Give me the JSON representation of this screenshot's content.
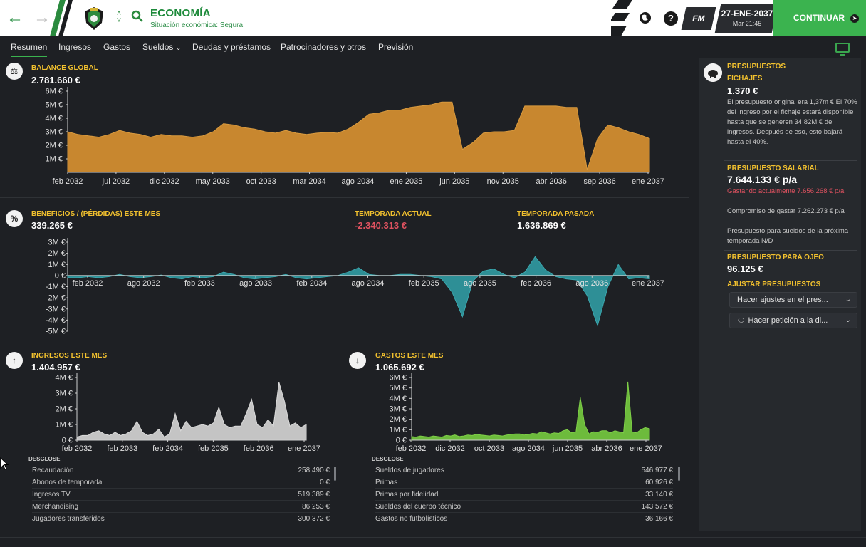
{
  "header": {
    "title": "ECONOMÍA",
    "subtitle": "Situación económica: Segura",
    "help_label": "?",
    "fm_label": "FM",
    "date": "27-ENE-2037",
    "time": "Mar 21:45",
    "continue_label": "CONTINUAR"
  },
  "tabs": [
    {
      "label": "Resumen",
      "active": true
    },
    {
      "label": "Ingresos"
    },
    {
      "label": "Gastos"
    },
    {
      "label": "Sueldos"
    },
    {
      "label": "Deudas y préstamos"
    },
    {
      "label": "Patrocinadores y otros"
    },
    {
      "label": "Previsión"
    }
  ],
  "balance": {
    "label": "BALANCE GLOBAL",
    "value": "2.781.660 €"
  },
  "profit": {
    "label": "BENEFICIOS / (PÉRDIDAS) ESTE MES",
    "value": "339.265 €",
    "current_season_label": "TEMPORADA ACTUAL",
    "current_season_value": "-2.340.313 €",
    "last_season_label": "TEMPORADA PASADA",
    "last_season_value": "1.636.869 €"
  },
  "income": {
    "label": "INGRESOS ESTE MES",
    "value": "1.404.957 €",
    "breakdown_label": "DESGLOSE",
    "rows": [
      {
        "name": "Recaudación",
        "value": "258.490 €"
      },
      {
        "name": "Abonos de temporada",
        "value": "0 €"
      },
      {
        "name": "Ingresos TV",
        "value": "519.389 €"
      },
      {
        "name": "Merchandising",
        "value": "86.253 €"
      },
      {
        "name": "Jugadores transferidos",
        "value": "300.372 €"
      }
    ]
  },
  "expenses": {
    "label": "GASTOS ESTE MES",
    "value": "1.065.692 €",
    "breakdown_label": "DESGLOSE",
    "rows": [
      {
        "name": "Sueldos de jugadores",
        "value": "546.977 €"
      },
      {
        "name": "Primas",
        "value": "60.926 €"
      },
      {
        "name": "Primas por fidelidad",
        "value": "33.140 €"
      },
      {
        "name": "Sueldos del cuerpo técnico",
        "value": "143.572 €"
      },
      {
        "name": "Gastos no futbolísticos",
        "value": "36.166 €"
      }
    ]
  },
  "budgets": {
    "label": "PRESUPUESTOS",
    "transfers_label": "FICHAJES",
    "transfers_value": "1.370 €",
    "transfers_text": "El presupuesto original era 1,37m € El 70% del ingreso por el fichaje estará disponible hasta que se generen 34,82M € de ingresos. Después de eso, esto bajará hasta el 40%.",
    "wage_label": "PRESUPUESTO SALARIAL",
    "wage_value": "7.644.133 € p/a",
    "wage_spending": "Gastando actualmente 7.656.268 € p/a",
    "wage_commit": "Compromiso de gastar 7.262.273 € p/a",
    "wage_next": "Presupuesto para sueldos de la próxima temporada N/D",
    "scouting_label": "PRESUPUESTO PARA OJEO",
    "scouting_value": "96.125 €",
    "adjust_label": "AJUSTAR PRESUPUESTOS",
    "adjust_dropdown": "Hacer ajustes en el pres...",
    "request_dropdown": "Hacer petición a la di..."
  },
  "colors": {
    "accent": "#3bb34f",
    "balance_fill": "#c8872f",
    "profit_fill": "#2e8f96",
    "income_fill": "#c4c4c4",
    "expense_fill": "#6dbb3c",
    "label_yellow": "#f2c12e",
    "negative": "#e05260"
  },
  "chart_data": [
    {
      "type": "area",
      "title": "BALANCE GLOBAL",
      "x_tick_labels": [
        "feb 2032",
        "jul 2032",
        "dic 2032",
        "may 2033",
        "oct 2033",
        "mar 2034",
        "ago 2034",
        "ene 2035",
        "jun 2035",
        "nov 2035",
        "abr 2036",
        "sep 2036",
        "ene 2037"
      ],
      "y_tick_labels": [
        "1M €",
        "2M €",
        "3M €",
        "4M €",
        "5M €",
        "6M €"
      ],
      "ylim": [
        0,
        6
      ],
      "series": [
        {
          "values": [
            3.0,
            2.8,
            2.7,
            2.6,
            2.8,
            3.1,
            2.9,
            2.8,
            2.6,
            2.8,
            2.7,
            2.7,
            2.6,
            2.7,
            3.0,
            3.6,
            3.5,
            3.3,
            3.2,
            3.0,
            2.9,
            3.1,
            2.9,
            2.8,
            2.9,
            2.95,
            2.9,
            3.2,
            3.7,
            4.3,
            4.4,
            4.6,
            4.6,
            4.8,
            4.9,
            5.0,
            5.2,
            5.2,
            1.7,
            2.2,
            2.9,
            3.0,
            3.0,
            3.1,
            4.9,
            4.9,
            4.9,
            4.9,
            4.8,
            4.8,
            0.2,
            2.5,
            3.5,
            3.3,
            3.0,
            2.8,
            2.5
          ]
        }
      ]
    },
    {
      "type": "area",
      "title": "BENEFICIOS / (PÉRDIDAS) ESTE MES",
      "x_tick_labels": [
        "feb 2032",
        "ago 2032",
        "feb 2033",
        "ago 2033",
        "feb 2034",
        "ago 2034",
        "feb 2035",
        "ago 2035",
        "feb 2036",
        "ago 2036",
        "ene 2037"
      ],
      "y_tick_labels": [
        "3M €",
        "2M €",
        "1M €",
        "0 €",
        "-1M €",
        "-2M €",
        "-3M €",
        "-4M €",
        "-5M €"
      ],
      "ylim": [
        -5,
        3
      ],
      "series": [
        {
          "values": [
            -0.2,
            -0.2,
            -0.1,
            -0.2,
            -0.1,
            0.1,
            -0.1,
            -0.2,
            -0.1,
            0.05,
            -0.2,
            -0.3,
            -0.1,
            -0.2,
            -0.1,
            0.3,
            0.1,
            -0.2,
            -0.3,
            -0.2,
            -0.1,
            0.1,
            -0.2,
            -0.3,
            -0.2,
            -0.1,
            0.0,
            0.3,
            0.7,
            0.1,
            0.0,
            0.0,
            0.1,
            0.1,
            0.0,
            -0.1,
            -0.3,
            -1.5,
            -3.7,
            -0.5,
            0.4,
            0.6,
            0.1,
            -0.2,
            0.3,
            1.7,
            0.5,
            -0.1,
            -0.3,
            -0.4,
            -1.8,
            -4.5,
            -1.0,
            1.0,
            -0.3,
            -0.2,
            -0.3
          ]
        }
      ]
    },
    {
      "type": "area",
      "title": "INGRESOS ESTE MES",
      "x_tick_labels": [
        "feb 2032",
        "feb 2033",
        "feb 2034",
        "feb 2035",
        "feb 2036",
        "ene 2037"
      ],
      "y_tick_labels": [
        "0 €",
        "1M €",
        "2M €",
        "3M €",
        "4M €"
      ],
      "ylim": [
        0,
        4
      ],
      "series": [
        {
          "values": [
            0.2,
            0.3,
            0.3,
            0.5,
            0.6,
            0.4,
            0.3,
            0.5,
            0.3,
            0.4,
            0.6,
            1.2,
            0.5,
            0.3,
            0.4,
            0.7,
            0.2,
            0.4,
            1.7,
            0.6,
            1.2,
            0.8,
            0.9,
            1.0,
            0.9,
            1.1,
            2.1,
            1.0,
            0.8,
            0.9,
            0.9,
            1.7,
            2.6,
            1.0,
            0.8,
            1.3,
            0.9,
            3.7,
            2.5,
            0.9,
            1.1,
            0.8,
            1.0
          ]
        }
      ]
    },
    {
      "type": "area",
      "title": "GASTOS ESTE MES",
      "x_tick_labels": [
        "feb 2032",
        "dic 2032",
        "oct 2033",
        "ago 2034",
        "jun 2035",
        "abr 2036",
        "ene 2037"
      ],
      "y_tick_labels": [
        "0 €",
        "1M €",
        "2M €",
        "3M €",
        "4M €",
        "5M €",
        "6M €"
      ],
      "ylim": [
        0,
        6
      ],
      "series": [
        {
          "values": [
            0.35,
            0.3,
            0.4,
            0.35,
            0.3,
            0.4,
            0.35,
            0.3,
            0.45,
            0.4,
            0.5,
            0.35,
            0.4,
            0.5,
            0.45,
            0.55,
            0.5,
            0.45,
            0.4,
            0.5,
            0.45,
            0.4,
            0.5,
            0.55,
            0.6,
            0.6,
            0.5,
            0.55,
            0.65,
            0.6,
            0.8,
            0.7,
            0.6,
            0.7,
            0.65,
            0.9,
            1.0,
            0.7,
            0.8,
            4.1,
            1.5,
            0.6,
            0.8,
            0.75,
            0.9,
            0.9,
            0.7,
            0.9,
            0.8,
            0.7,
            5.6,
            0.8,
            0.7,
            1.0,
            1.2,
            1.1
          ]
        }
      ]
    }
  ]
}
